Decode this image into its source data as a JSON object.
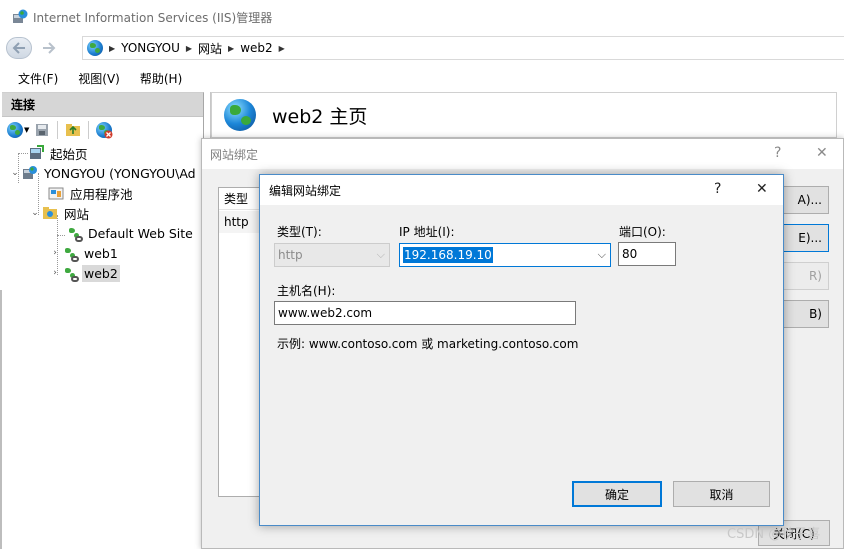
{
  "window": {
    "title": "Internet Information Services (IIS)管理器"
  },
  "address": {
    "crumbs": [
      "YONGYOU",
      "网站",
      "web2"
    ]
  },
  "menu": {
    "items": [
      "文件(F)",
      "视图(V)",
      "帮助(H)"
    ]
  },
  "connections": {
    "header": "连接",
    "tree": {
      "start_page": "起始页",
      "server": "YONGYOU (YONGYOU\\Ad",
      "app_pools": "应用程序池",
      "sites": "网站",
      "site_items": [
        "Default Web Site",
        "web1",
        "web2"
      ],
      "selected": "web2"
    }
  },
  "home": {
    "title": "web2 主页"
  },
  "bindings_dialog": {
    "title": "网站绑定",
    "help": "?",
    "close": "✕",
    "column_type": "类型",
    "rows": [
      "http"
    ],
    "buttons": {
      "add_partial": "A)...",
      "edit_partial": "E)...",
      "remove_partial": "R)",
      "browse_partial": "B)",
      "close_partial": "关闭(C)"
    }
  },
  "edit_binding": {
    "title": "编辑网站绑定",
    "help": "?",
    "close": "✕",
    "type_label": "类型(T):",
    "type_value": "http",
    "ip_label": "IP 地址(I):",
    "ip_value": "192.168.19.10",
    "port_label": "端口(O):",
    "port_value": "80",
    "host_label": "主机名(H):",
    "host_value": "www.web2.com",
    "example": "示例: www.contoso.com 或 marketing.contoso.com",
    "ok": "确定",
    "cancel": "取消"
  },
  "watermark": "CSDN @秋子喜"
}
